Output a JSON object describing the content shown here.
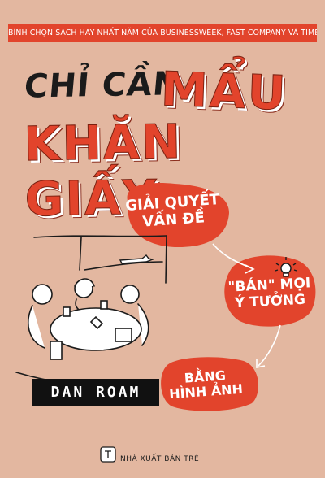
{
  "cover": {
    "background_color": "#e3b7a0",
    "accent_color": "#e2442c",
    "banner_text": "BÌNH CHỌN SÁCH HAY NHẤT NĂM CỦA BUSINESSWEEK, FAST COMPANY VÀ TIMES",
    "title_line1_black": "CHỈ CẦN",
    "title_line1_red": "MẨU",
    "title_line2_red": "KHĂN GIẤY",
    "bubble_1": [
      "GIẢI QUYẾT",
      "VẤN ĐỀ"
    ],
    "bubble_2": [
      "\"BÁN\" MỌI",
      "Ý TƯỞNG"
    ],
    "bubble_3": [
      "BẰNG",
      "HÌNH ẢNH"
    ],
    "author": "DAN ROAM",
    "publisher": "NHÀ XUẤT BẢN TRẺ",
    "icons": [
      "lightbulb-icon",
      "airplane-icon",
      "publisher-logo-icon"
    ]
  }
}
